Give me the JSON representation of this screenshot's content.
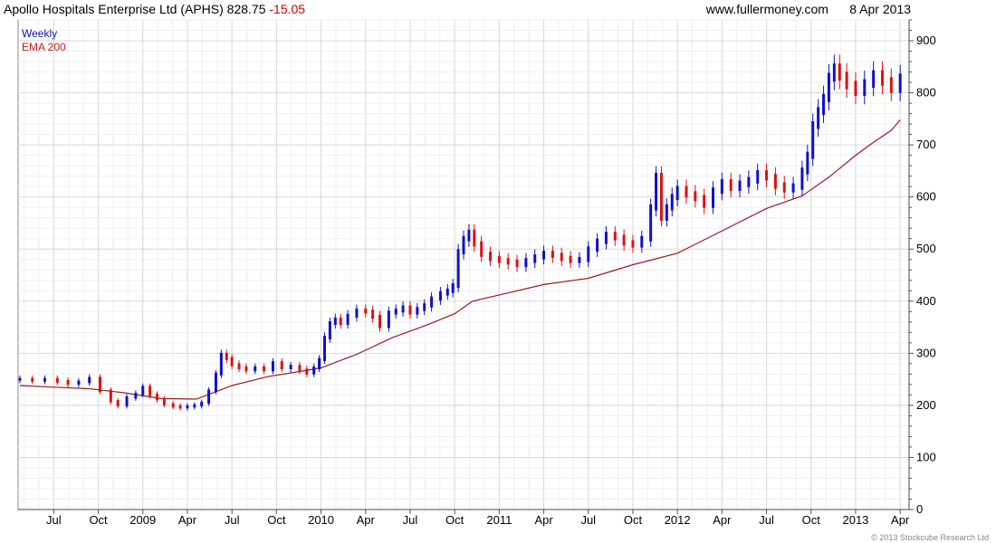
{
  "header": {
    "title": "Apollo Hospitals Enterprise Ltd (APHS) 828.75",
    "change": "-15.05",
    "site": "www.fullermoney.com",
    "date": "8 Apr 2013"
  },
  "legend": {
    "period": "Weekly",
    "ema": "EMA 200"
  },
  "copyright": "© 2013 Stockcube Research Ltd",
  "chart_data": {
    "type": "line",
    "title": "Apollo Hospitals Enterprise Ltd (APHS) 828.75 -15.05",
    "ylim": [
      0,
      940
    ],
    "xlim": [
      2008.3,
      2013.3
    ],
    "grid": true,
    "y_axis_position": "right",
    "yticks": [
      0,
      100,
      200,
      300,
      400,
      500,
      600,
      700,
      800,
      900
    ],
    "xticks": [
      {
        "label": "Jul",
        "x": 2008.5
      },
      {
        "label": "Oct",
        "x": 2008.75
      },
      {
        "label": "2009",
        "x": 2009.0
      },
      {
        "label": "Apr",
        "x": 2009.25
      },
      {
        "label": "Jul",
        "x": 2009.5
      },
      {
        "label": "Oct",
        "x": 2009.75
      },
      {
        "label": "2010",
        "x": 2010.0
      },
      {
        "label": "Apr",
        "x": 2010.25
      },
      {
        "label": "Jul",
        "x": 2010.5
      },
      {
        "label": "Oct",
        "x": 2010.75
      },
      {
        "label": "2011",
        "x": 2011.0
      },
      {
        "label": "Apr",
        "x": 2011.25
      },
      {
        "label": "Jul",
        "x": 2011.5
      },
      {
        "label": "Oct",
        "x": 2011.75
      },
      {
        "label": "2012",
        "x": 2012.0
      },
      {
        "label": "Apr",
        "x": 2012.25
      },
      {
        "label": "Jul",
        "x": 2012.5
      },
      {
        "label": "Oct",
        "x": 2012.75
      },
      {
        "label": "2013",
        "x": 2013.0
      },
      {
        "label": "Apr",
        "x": 2013.25
      }
    ],
    "price_series": {
      "name": "Weekly",
      "color_up": "#1010cc",
      "color_down": "#dd1111",
      "points": [
        [
          2008.31,
          250
        ],
        [
          2008.38,
          248
        ],
        [
          2008.45,
          250
        ],
        [
          2008.52,
          246
        ],
        [
          2008.58,
          242
        ],
        [
          2008.64,
          245
        ],
        [
          2008.7,
          252
        ],
        [
          2008.76,
          228
        ],
        [
          2008.82,
          208
        ],
        [
          2008.86,
          200
        ],
        [
          2008.91,
          215
        ],
        [
          2008.96,
          222
        ],
        [
          2009.0,
          235
        ],
        [
          2009.04,
          220
        ],
        [
          2009.08,
          212
        ],
        [
          2009.12,
          202
        ],
        [
          2009.17,
          198
        ],
        [
          2009.21,
          196
        ],
        [
          2009.25,
          198
        ],
        [
          2009.29,
          200
        ],
        [
          2009.33,
          205
        ],
        [
          2009.37,
          228
        ],
        [
          2009.41,
          260
        ],
        [
          2009.44,
          298
        ],
        [
          2009.47,
          290
        ],
        [
          2009.5,
          278
        ],
        [
          2009.54,
          272
        ],
        [
          2009.58,
          268
        ],
        [
          2009.63,
          272
        ],
        [
          2009.68,
          268
        ],
        [
          2009.73,
          282
        ],
        [
          2009.78,
          272
        ],
        [
          2009.83,
          275
        ],
        [
          2009.88,
          268
        ],
        [
          2009.92,
          262
        ],
        [
          2009.96,
          272
        ],
        [
          2009.99,
          288
        ],
        [
          2010.02,
          330
        ],
        [
          2010.05,
          358
        ],
        [
          2010.08,
          365
        ],
        [
          2010.11,
          358
        ],
        [
          2010.15,
          372
        ],
        [
          2010.2,
          382
        ],
        [
          2010.25,
          380
        ],
        [
          2010.29,
          370
        ],
        [
          2010.33,
          352
        ],
        [
          2010.38,
          378
        ],
        [
          2010.42,
          382
        ],
        [
          2010.46,
          388
        ],
        [
          2010.5,
          378
        ],
        [
          2010.54,
          385
        ],
        [
          2010.58,
          392
        ],
        [
          2010.62,
          405
        ],
        [
          2010.67,
          415
        ],
        [
          2010.71,
          420
        ],
        [
          2010.74,
          430
        ],
        [
          2010.77,
          495
        ],
        [
          2010.8,
          520
        ],
        [
          2010.83,
          532
        ],
        [
          2010.86,
          510
        ],
        [
          2010.9,
          490
        ],
        [
          2010.95,
          482
        ],
        [
          2011.0,
          478
        ],
        [
          2011.05,
          475
        ],
        [
          2011.1,
          470
        ],
        [
          2011.15,
          478
        ],
        [
          2011.2,
          485
        ],
        [
          2011.25,
          492
        ],
        [
          2011.3,
          488
        ],
        [
          2011.35,
          482
        ],
        [
          2011.4,
          478
        ],
        [
          2011.45,
          480
        ],
        [
          2011.5,
          500
        ],
        [
          2011.55,
          515
        ],
        [
          2011.6,
          528
        ],
        [
          2011.65,
          522
        ],
        [
          2011.7,
          512
        ],
        [
          2011.75,
          508
        ],
        [
          2011.8,
          520
        ],
        [
          2011.85,
          580
        ],
        [
          2011.88,
          640
        ],
        [
          2011.91,
          560
        ],
        [
          2011.94,
          580
        ],
        [
          2011.97,
          600
        ],
        [
          2012.0,
          615
        ],
        [
          2012.05,
          605
        ],
        [
          2012.1,
          598
        ],
        [
          2012.15,
          585
        ],
        [
          2012.2,
          612
        ],
        [
          2012.25,
          628
        ],
        [
          2012.3,
          618
        ],
        [
          2012.35,
          625
        ],
        [
          2012.4,
          632
        ],
        [
          2012.45,
          645
        ],
        [
          2012.5,
          638
        ],
        [
          2012.55,
          622
        ],
        [
          2012.6,
          615
        ],
        [
          2012.65,
          620
        ],
        [
          2012.7,
          650
        ],
        [
          2012.73,
          680
        ],
        [
          2012.76,
          738
        ],
        [
          2012.79,
          765
        ],
        [
          2012.82,
          790
        ],
        [
          2012.85,
          830
        ],
        [
          2012.88,
          848
        ],
        [
          2012.91,
          832
        ],
        [
          2012.95,
          815
        ],
        [
          2013.0,
          802
        ],
        [
          2013.05,
          818
        ],
        [
          2013.1,
          835
        ],
        [
          2013.15,
          822
        ],
        [
          2013.2,
          808
        ],
        [
          2013.25,
          828.75
        ]
      ]
    },
    "ema_series": {
      "name": "EMA 200",
      "color": "#9b1b1b",
      "points": [
        [
          2008.31,
          238
        ],
        [
          2008.5,
          235
        ],
        [
          2008.7,
          232
        ],
        [
          2008.9,
          224
        ],
        [
          2009.1,
          213
        ],
        [
          2009.3,
          212
        ],
        [
          2009.5,
          238
        ],
        [
          2009.7,
          255
        ],
        [
          2009.9,
          266
        ],
        [
          2010.0,
          272
        ],
        [
          2010.2,
          298
        ],
        [
          2010.4,
          330
        ],
        [
          2010.6,
          355
        ],
        [
          2010.75,
          376
        ],
        [
          2010.85,
          400
        ],
        [
          2011.0,
          412
        ],
        [
          2011.25,
          432
        ],
        [
          2011.5,
          444
        ],
        [
          2011.75,
          470
        ],
        [
          2012.0,
          492
        ],
        [
          2012.25,
          535
        ],
        [
          2012.5,
          578
        ],
        [
          2012.7,
          602
        ],
        [
          2012.85,
          638
        ],
        [
          2013.0,
          680
        ],
        [
          2013.1,
          705
        ],
        [
          2013.2,
          728
        ],
        [
          2013.25,
          748
        ]
      ]
    },
    "annotations": []
  }
}
